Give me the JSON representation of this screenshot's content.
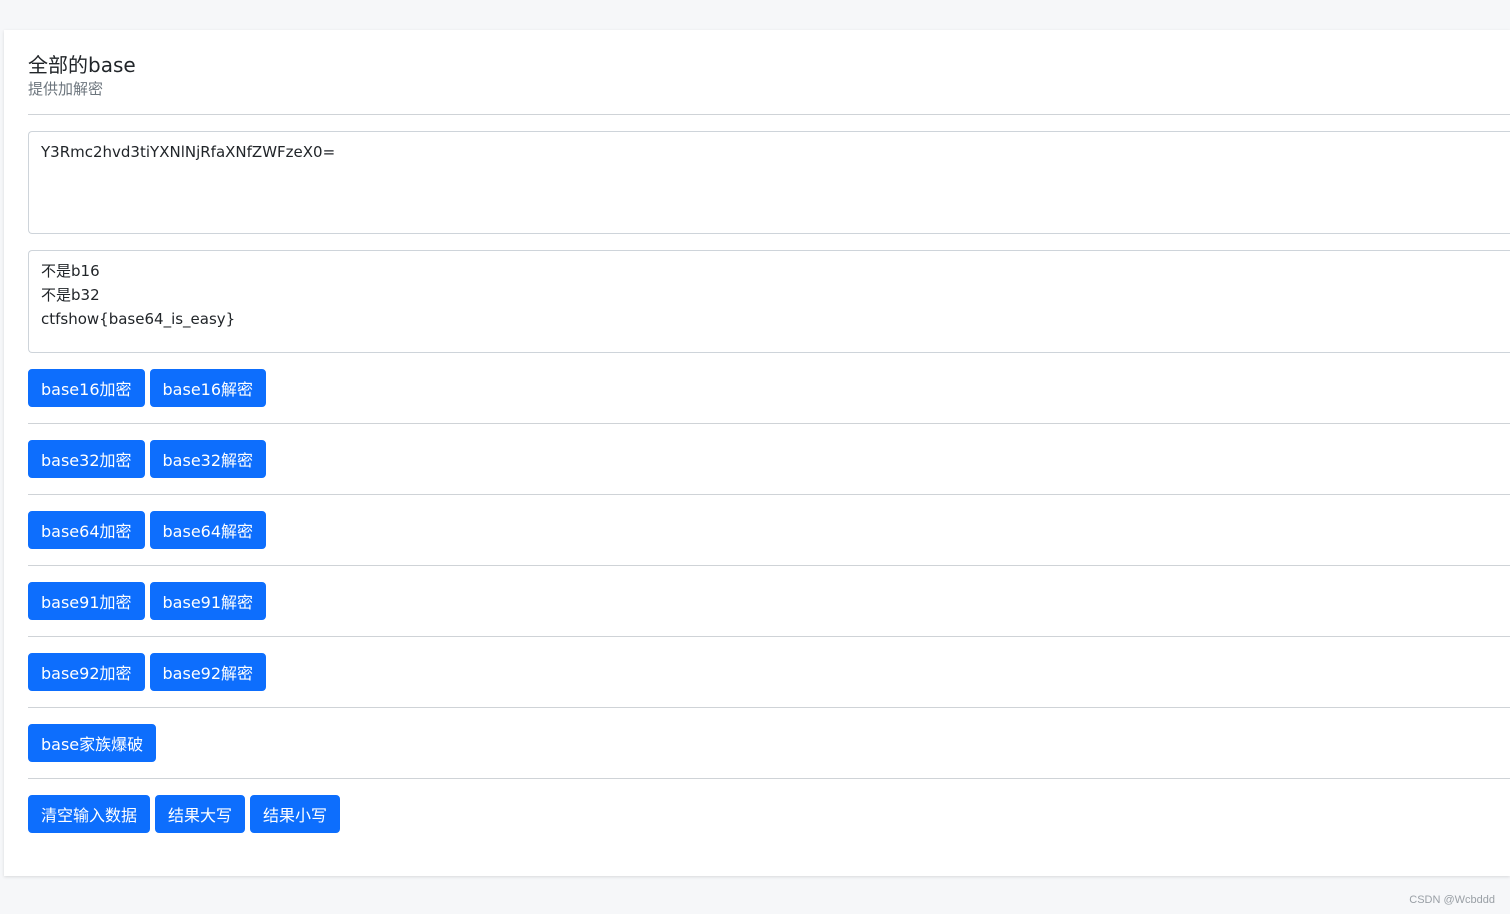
{
  "header": {
    "title": "全部的base",
    "subtitle": "提供加解密"
  },
  "input": {
    "value": "Y3Rmc2hvd3tiYXNlNjRfaXNfZWFzeX0="
  },
  "output": {
    "value": "不是b16\n不是b32\nctfshow{base64_is_easy}"
  },
  "buttons": {
    "b16_encode": "base16加密",
    "b16_decode": "base16解密",
    "b32_encode": "base32加密",
    "b32_decode": "base32解密",
    "b64_encode": "base64加密",
    "b64_decode": "base64解密",
    "b91_encode": "base91加密",
    "b91_decode": "base91解密",
    "b92_encode": "base92加密",
    "b92_decode": "base92解密",
    "brute": "base家族爆破",
    "clear": "清空输入数据",
    "upper": "结果大写",
    "lower": "结果小写"
  },
  "watermark": "CSDN @Wcbddd",
  "colors": {
    "accent": "#0d6efd",
    "background": "#f6f7f9"
  }
}
